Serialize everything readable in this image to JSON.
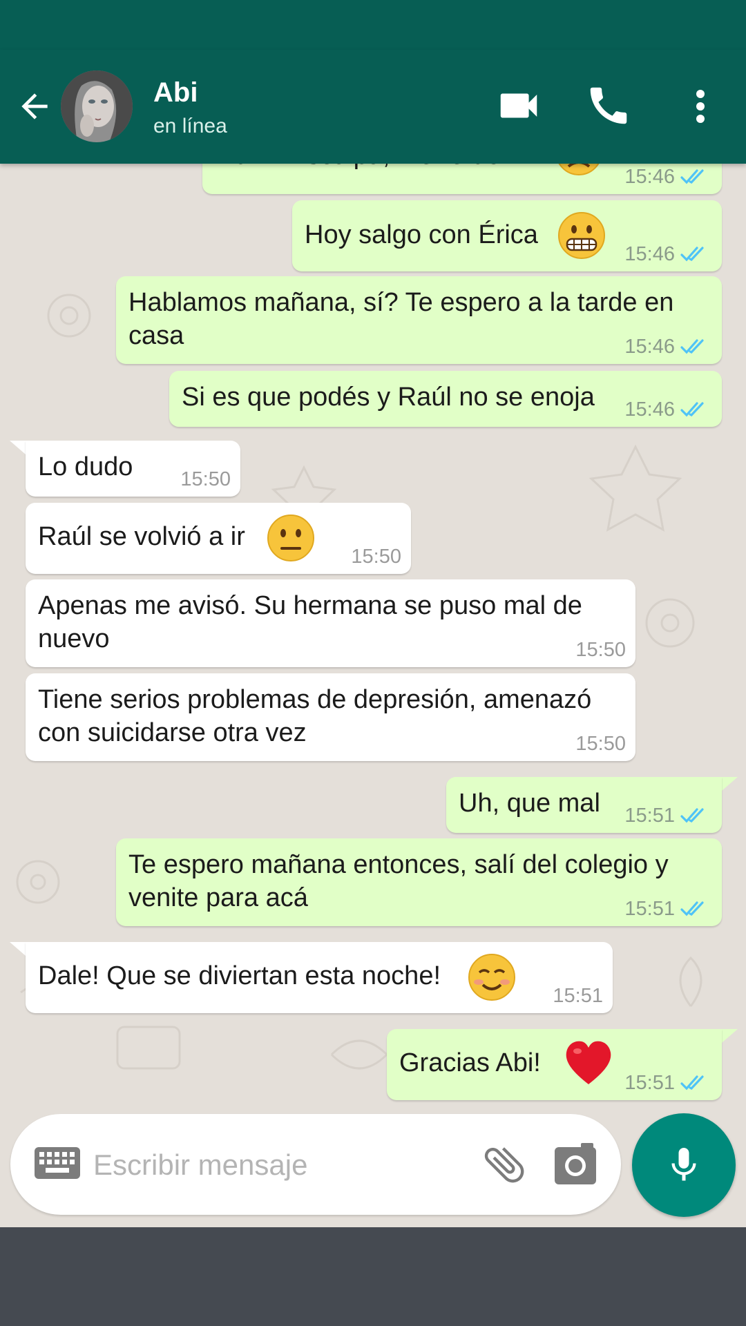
{
  "header": {
    "contact_name": "Abi",
    "contact_status": "en línea",
    "icons": [
      "back-arrow-icon",
      "video-camera-icon",
      "phone-icon",
      "more-vert-icon"
    ]
  },
  "messages": [
    {
      "id": 0,
      "direction": "outgoing",
      "text": "Abi... Disculpa, me re dormí",
      "time": "15:46",
      "emoji": "disappointed-face",
      "read": true
    },
    {
      "id": 1,
      "direction": "outgoing",
      "text": "Hoy salgo con Érica",
      "time": "15:46",
      "emoji": "grimacing-face",
      "read": true
    },
    {
      "id": 2,
      "direction": "outgoing",
      "text": "Hablamos mañana, sí? Te espero a la tarde en\ncasa",
      "time": "15:46",
      "read": true
    },
    {
      "id": 3,
      "direction": "outgoing",
      "text": "Si es que podés y Raúl no se enoja",
      "time": "15:46",
      "read": true
    },
    {
      "id": 4,
      "direction": "incoming",
      "text": "Lo dudo",
      "time": "15:50"
    },
    {
      "id": 5,
      "direction": "incoming",
      "text": "Raúl se volvió a ir",
      "time": "15:50",
      "emoji": "neutral-face"
    },
    {
      "id": 6,
      "direction": "incoming",
      "text": "Apenas me avisó. Su hermana se puso mal de\nnuevo",
      "time": "15:50"
    },
    {
      "id": 7,
      "direction": "incoming",
      "text": "Tiene serios problemas de depresión, amenazó\ncon suicidarse otra vez",
      "time": "15:50"
    },
    {
      "id": 8,
      "direction": "outgoing",
      "text": "Uh, que mal",
      "time": "15:51",
      "read": true
    },
    {
      "id": 9,
      "direction": "outgoing",
      "text": "Te espero mañana entonces, salí del colegio y\nvenite para acá",
      "time": "15:51",
      "read": true
    },
    {
      "id": 10,
      "direction": "incoming",
      "text": "Dale! Que se diviertan esta noche!",
      "time": "15:51",
      "emoji": "smiling-face"
    },
    {
      "id": 11,
      "direction": "outgoing",
      "text": "Gracias Abi!",
      "time": "15:51",
      "emoji": "red-heart",
      "read": true
    }
  ],
  "composer": {
    "placeholder": "Escribir mensaje",
    "icons": [
      "keyboard-icon",
      "paperclip-icon",
      "camera-icon",
      "microphone-icon"
    ]
  },
  "colors": {
    "header": "#075e54",
    "outgoing_bubble": "#e1ffc7",
    "incoming_bubble": "#ffffff",
    "read_ticks": "#4fc3f7",
    "mic_button": "#00897b",
    "nav_bar": "#454a51"
  }
}
